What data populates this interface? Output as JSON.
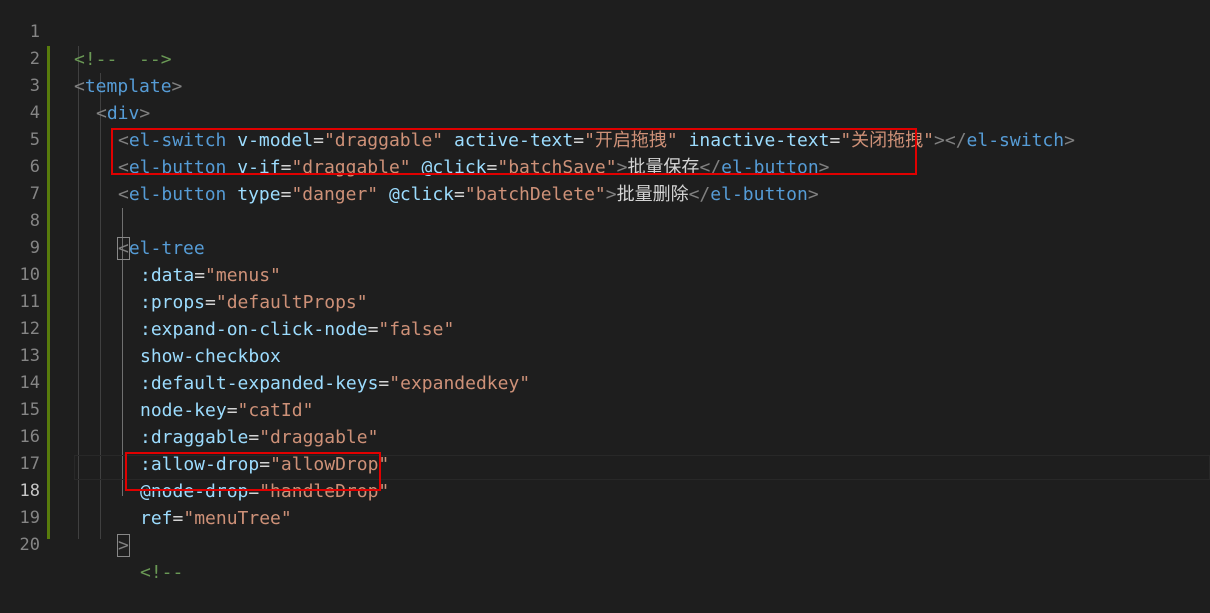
{
  "editor": {
    "line_numbers": [
      "1",
      "2",
      "3",
      "4",
      "5",
      "6",
      "7",
      "8",
      "9",
      "10",
      "11",
      "12",
      "13",
      "14",
      "15",
      "16",
      "17",
      "18",
      "19",
      "20"
    ],
    "lines": {
      "l1": {
        "open": "<!--",
        "close": "-->"
      },
      "l2": {
        "lt": "<",
        "tag": "template",
        "gt": ">"
      },
      "l3": {
        "lt": "<",
        "tag": "div",
        "gt": ">"
      },
      "l4": {
        "lt": "<",
        "tag": "el-switch",
        "a1": "v-model",
        "v1": "\"draggable\"",
        "a2": "active-text",
        "v2": "\"开启拖拽\"",
        "a3": "inactive-text",
        "v3": "\"关闭拖拽\"",
        "gt": ">",
        "close_lt": "</",
        "close_tag": "el-switch",
        "close_gt": ">"
      },
      "l5": {
        "lt": "<",
        "tag": "el-button",
        "a1": "v-if",
        "v1": "\"draggable\"",
        "a2": "@click",
        "v2": "\"batchSave\"",
        "gt": ">",
        "text": "批量保存",
        "close_lt": "</",
        "close_tag": "el-button",
        "close_gt": ">"
      },
      "l6": {
        "lt": "<",
        "tag": "el-button",
        "a1": "type",
        "v1": "\"danger\"",
        "a2": "@click",
        "v2": "\"batchDelete\"",
        "gt": ">",
        "text": "批量删除",
        "close_lt": "</",
        "close_tag": "el-button",
        "close_gt": ">"
      },
      "l8": {
        "lt": "<",
        "tag": "el-tree"
      },
      "l9": {
        "attr": ":data",
        "val": "\"menus\""
      },
      "l10": {
        "attr": ":props",
        "val": "\"defaultProps\""
      },
      "l11": {
        "attr": ":expand-on-click-node",
        "val": "\"false\""
      },
      "l12": {
        "attr": "show-checkbox"
      },
      "l13": {
        "attr": ":default-expanded-keys",
        "val": "\"expandedkey\""
      },
      "l14": {
        "attr": "node-key",
        "val": "\"catId\""
      },
      "l15": {
        "attr": ":draggable",
        "val": "\"draggable\""
      },
      "l16": {
        "attr": ":allow-drop",
        "val": "\"allowDrop\""
      },
      "l17": {
        "attr": "@node-drop",
        "val": "\"handleDrop\""
      },
      "l18": {
        "attr": "ref",
        "val": "\"menuTree\""
      },
      "l19": {
        "gt": ">"
      },
      "l20": {
        "open": "<!--"
      }
    },
    "colors": {
      "background": "#1e1e1e",
      "tag": "#569cd6",
      "attribute": "#9cdcfe",
      "string": "#ce9178",
      "comment": "#6a9955",
      "highlight_box": "#e00000",
      "modified_bar": "#587c0c"
    }
  }
}
